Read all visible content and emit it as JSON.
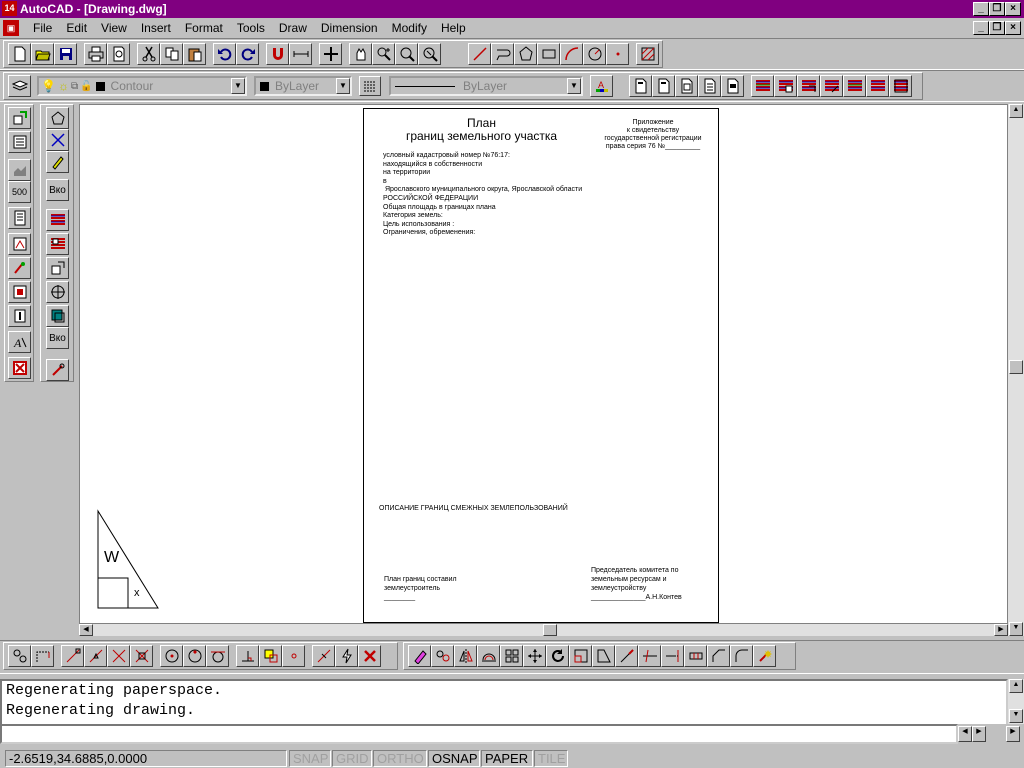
{
  "titlebar": {
    "app_icon": "14",
    "title": "AutoCAD - [Drawing.dwg]"
  },
  "menu": [
    "File",
    "Edit",
    "View",
    "Insert",
    "Format",
    "Tools",
    "Draw",
    "Dimension",
    "Modify",
    "Help"
  ],
  "properties": {
    "layer": "Contour",
    "color": "ByLayer",
    "linetype": "ByLayer"
  },
  "left_toolbar_labels": {
    "scale": "500",
    "ins1": "Вко",
    "ins2": "Вко"
  },
  "paper": {
    "title1": "План",
    "title2": "границ земельного участка",
    "appendix": [
      "Приложение",
      "к свидетельству",
      "государственной регистрации",
      "права серия 76 №_________"
    ],
    "lines": [
      "условный кадастровый номер №76:17:",
      "находящийся в собственности",
      "на территории",
      "в",
      " Ярославского муниципального округа, Ярославской области",
      "РОССИЙСКОЙ ФЕДЕРАЦИИ",
      "Общая площадь в границах плана",
      "Категория земель:",
      "Цель использования :",
      "Ограничения, обременения:"
    ],
    "description": "ОПИСАНИЕ ГРАНИЦ СМЕЖНЫХ ЗЕМЛЕПОЛЬЗОВАНИЙ",
    "left_sign": [
      "План границ составил",
      "землеустроитель",
      "________"
    ],
    "right_sign": [
      "Председатель комитета по",
      "земельным ресурсам и",
      "землеустройству",
      "______________А.Н.Контев"
    ]
  },
  "ucs": {
    "w_label": "W",
    "x_label": "x"
  },
  "command": {
    "history": [
      "Regenerating paperspace.",
      "Regenerating drawing."
    ],
    "current": ""
  },
  "status": {
    "coords": "-2.6519,34.6885,0.0000",
    "toggles": [
      {
        "label": "SNAP",
        "on": false
      },
      {
        "label": "GRID",
        "on": false
      },
      {
        "label": "ORTHO",
        "on": false
      },
      {
        "label": "OSNAP",
        "on": true
      },
      {
        "label": "PAPER",
        "on": true
      },
      {
        "label": "TILE",
        "on": false
      }
    ]
  }
}
